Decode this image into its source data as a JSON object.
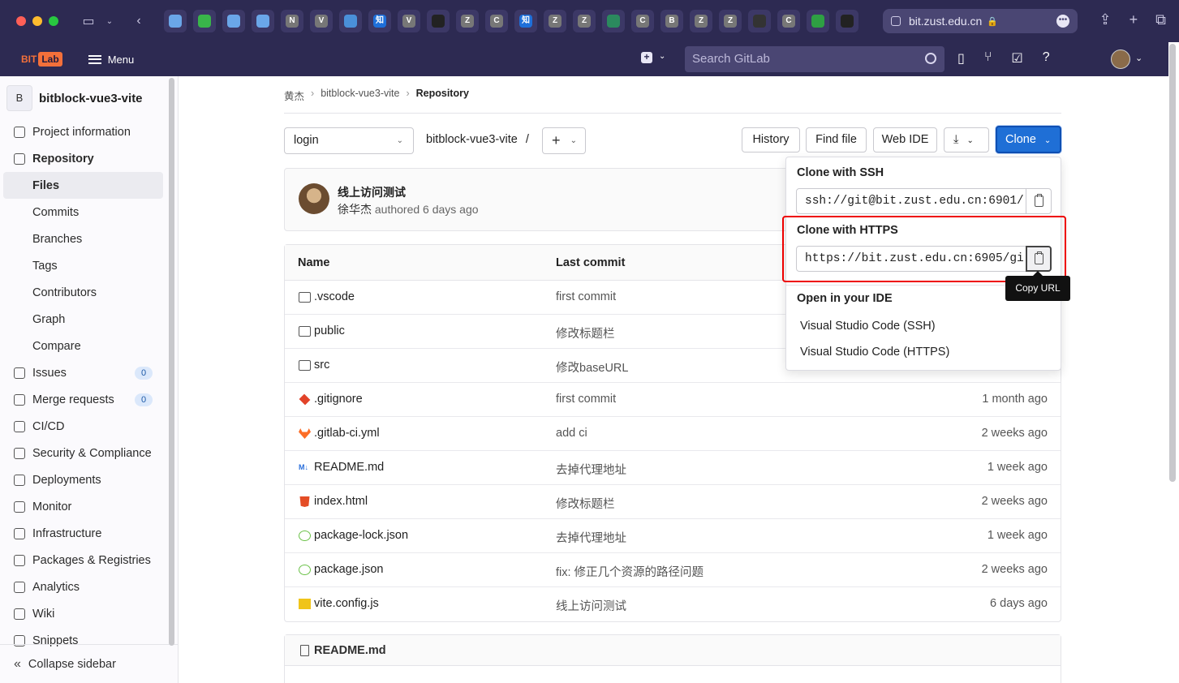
{
  "browser": {
    "url": "bit.zust.edu.cn",
    "tab_favicons": [
      "tab-icon",
      "tab-icon",
      "tab-icon",
      "tab-icon",
      "N",
      "V",
      "tab-icon",
      "知",
      "V",
      "github",
      "Z",
      "C",
      "知",
      "Z",
      "Z",
      "shield",
      "C",
      "B",
      "Z",
      "Z",
      "tab-icon",
      "C",
      "leaf",
      "github"
    ]
  },
  "header": {
    "logo_bit": "BIT",
    "logo_lab": "Lab",
    "menu_label": "Menu",
    "search_placeholder": "Search GitLab"
  },
  "sidebar": {
    "project_initial": "B",
    "project_name": "bitblock-vue3-vite",
    "items": [
      {
        "label": "Project information"
      },
      {
        "label": "Repository"
      },
      {
        "label": "Files"
      },
      {
        "label": "Commits"
      },
      {
        "label": "Branches"
      },
      {
        "label": "Tags"
      },
      {
        "label": "Contributors"
      },
      {
        "label": "Graph"
      },
      {
        "label": "Compare"
      },
      {
        "label": "Issues",
        "badge": "0"
      },
      {
        "label": "Merge requests",
        "badge": "0"
      },
      {
        "label": "CI/CD"
      },
      {
        "label": "Security & Compliance"
      },
      {
        "label": "Deployments"
      },
      {
        "label": "Monitor"
      },
      {
        "label": "Infrastructure"
      },
      {
        "label": "Packages & Registries"
      },
      {
        "label": "Analytics"
      },
      {
        "label": "Wiki"
      },
      {
        "label": "Snippets"
      }
    ],
    "collapse_label": "Collapse sidebar"
  },
  "breadcrumb": {
    "owner": "黄杰",
    "project": "bitblock-vue3-vite",
    "current": "Repository"
  },
  "toolbar": {
    "branch": "login",
    "path": "bitblock-vue3-vite",
    "path_sep": "/",
    "history": "History",
    "find_file": "Find file",
    "web_ide": "Web IDE",
    "clone": "Clone"
  },
  "last_commit": {
    "title": "线上访问测试",
    "author": "徐华杰",
    "meta": "authored 6 days ago"
  },
  "files_table": {
    "headers": {
      "name": "Name",
      "last_commit": "Last commit"
    },
    "rows": [
      {
        "name": ".vscode",
        "commit": "first commit",
        "when": "",
        "icon": "folder-icon"
      },
      {
        "name": "public",
        "commit": "修改标题栏",
        "when": "",
        "icon": "folder-icon"
      },
      {
        "name": "src",
        "commit": "修改baseURL",
        "when": "",
        "icon": "folder-icon"
      },
      {
        "name": ".gitignore",
        "commit": "first commit",
        "when": "1 month ago",
        "icon": "git-icon"
      },
      {
        "name": ".gitlab-ci.yml",
        "commit": "add ci",
        "when": "2 weeks ago",
        "icon": "gitlab-icon"
      },
      {
        "name": "README.md",
        "commit": "去掉代理地址",
        "when": "1 week ago",
        "icon": "markdown-icon"
      },
      {
        "name": "index.html",
        "commit": "修改标题栏",
        "when": "2 weeks ago",
        "icon": "html-icon"
      },
      {
        "name": "package-lock.json",
        "commit": "去掉代理地址",
        "when": "1 week ago",
        "icon": "nodejs-icon"
      },
      {
        "name": "package.json",
        "commit": "fix: 修正几个资源的路径问题",
        "when": "2 weeks ago",
        "icon": "nodejs-icon"
      },
      {
        "name": "vite.config.js",
        "commit": "线上访问测试",
        "when": "6 days ago",
        "icon": "javascript-icon"
      }
    ]
  },
  "readme": {
    "title": "README.md"
  },
  "clone_dropdown": {
    "ssh_label": "Clone with SSH",
    "ssh_url": "ssh://git@bit.zust.edu.cn:6901/",
    "https_label": "Clone with HTTPS",
    "https_url": "https://bit.zust.edu.cn:6905/gi",
    "ide_label": "Open in your IDE",
    "ide_ssh": "Visual Studio Code (SSH)",
    "ide_https": "Visual Studio Code (HTTPS)",
    "tooltip": "Copy URL"
  },
  "colors": {
    "clone_button": "#1f6fd6",
    "highlight": "#e00000",
    "header": "#2d2a52"
  }
}
